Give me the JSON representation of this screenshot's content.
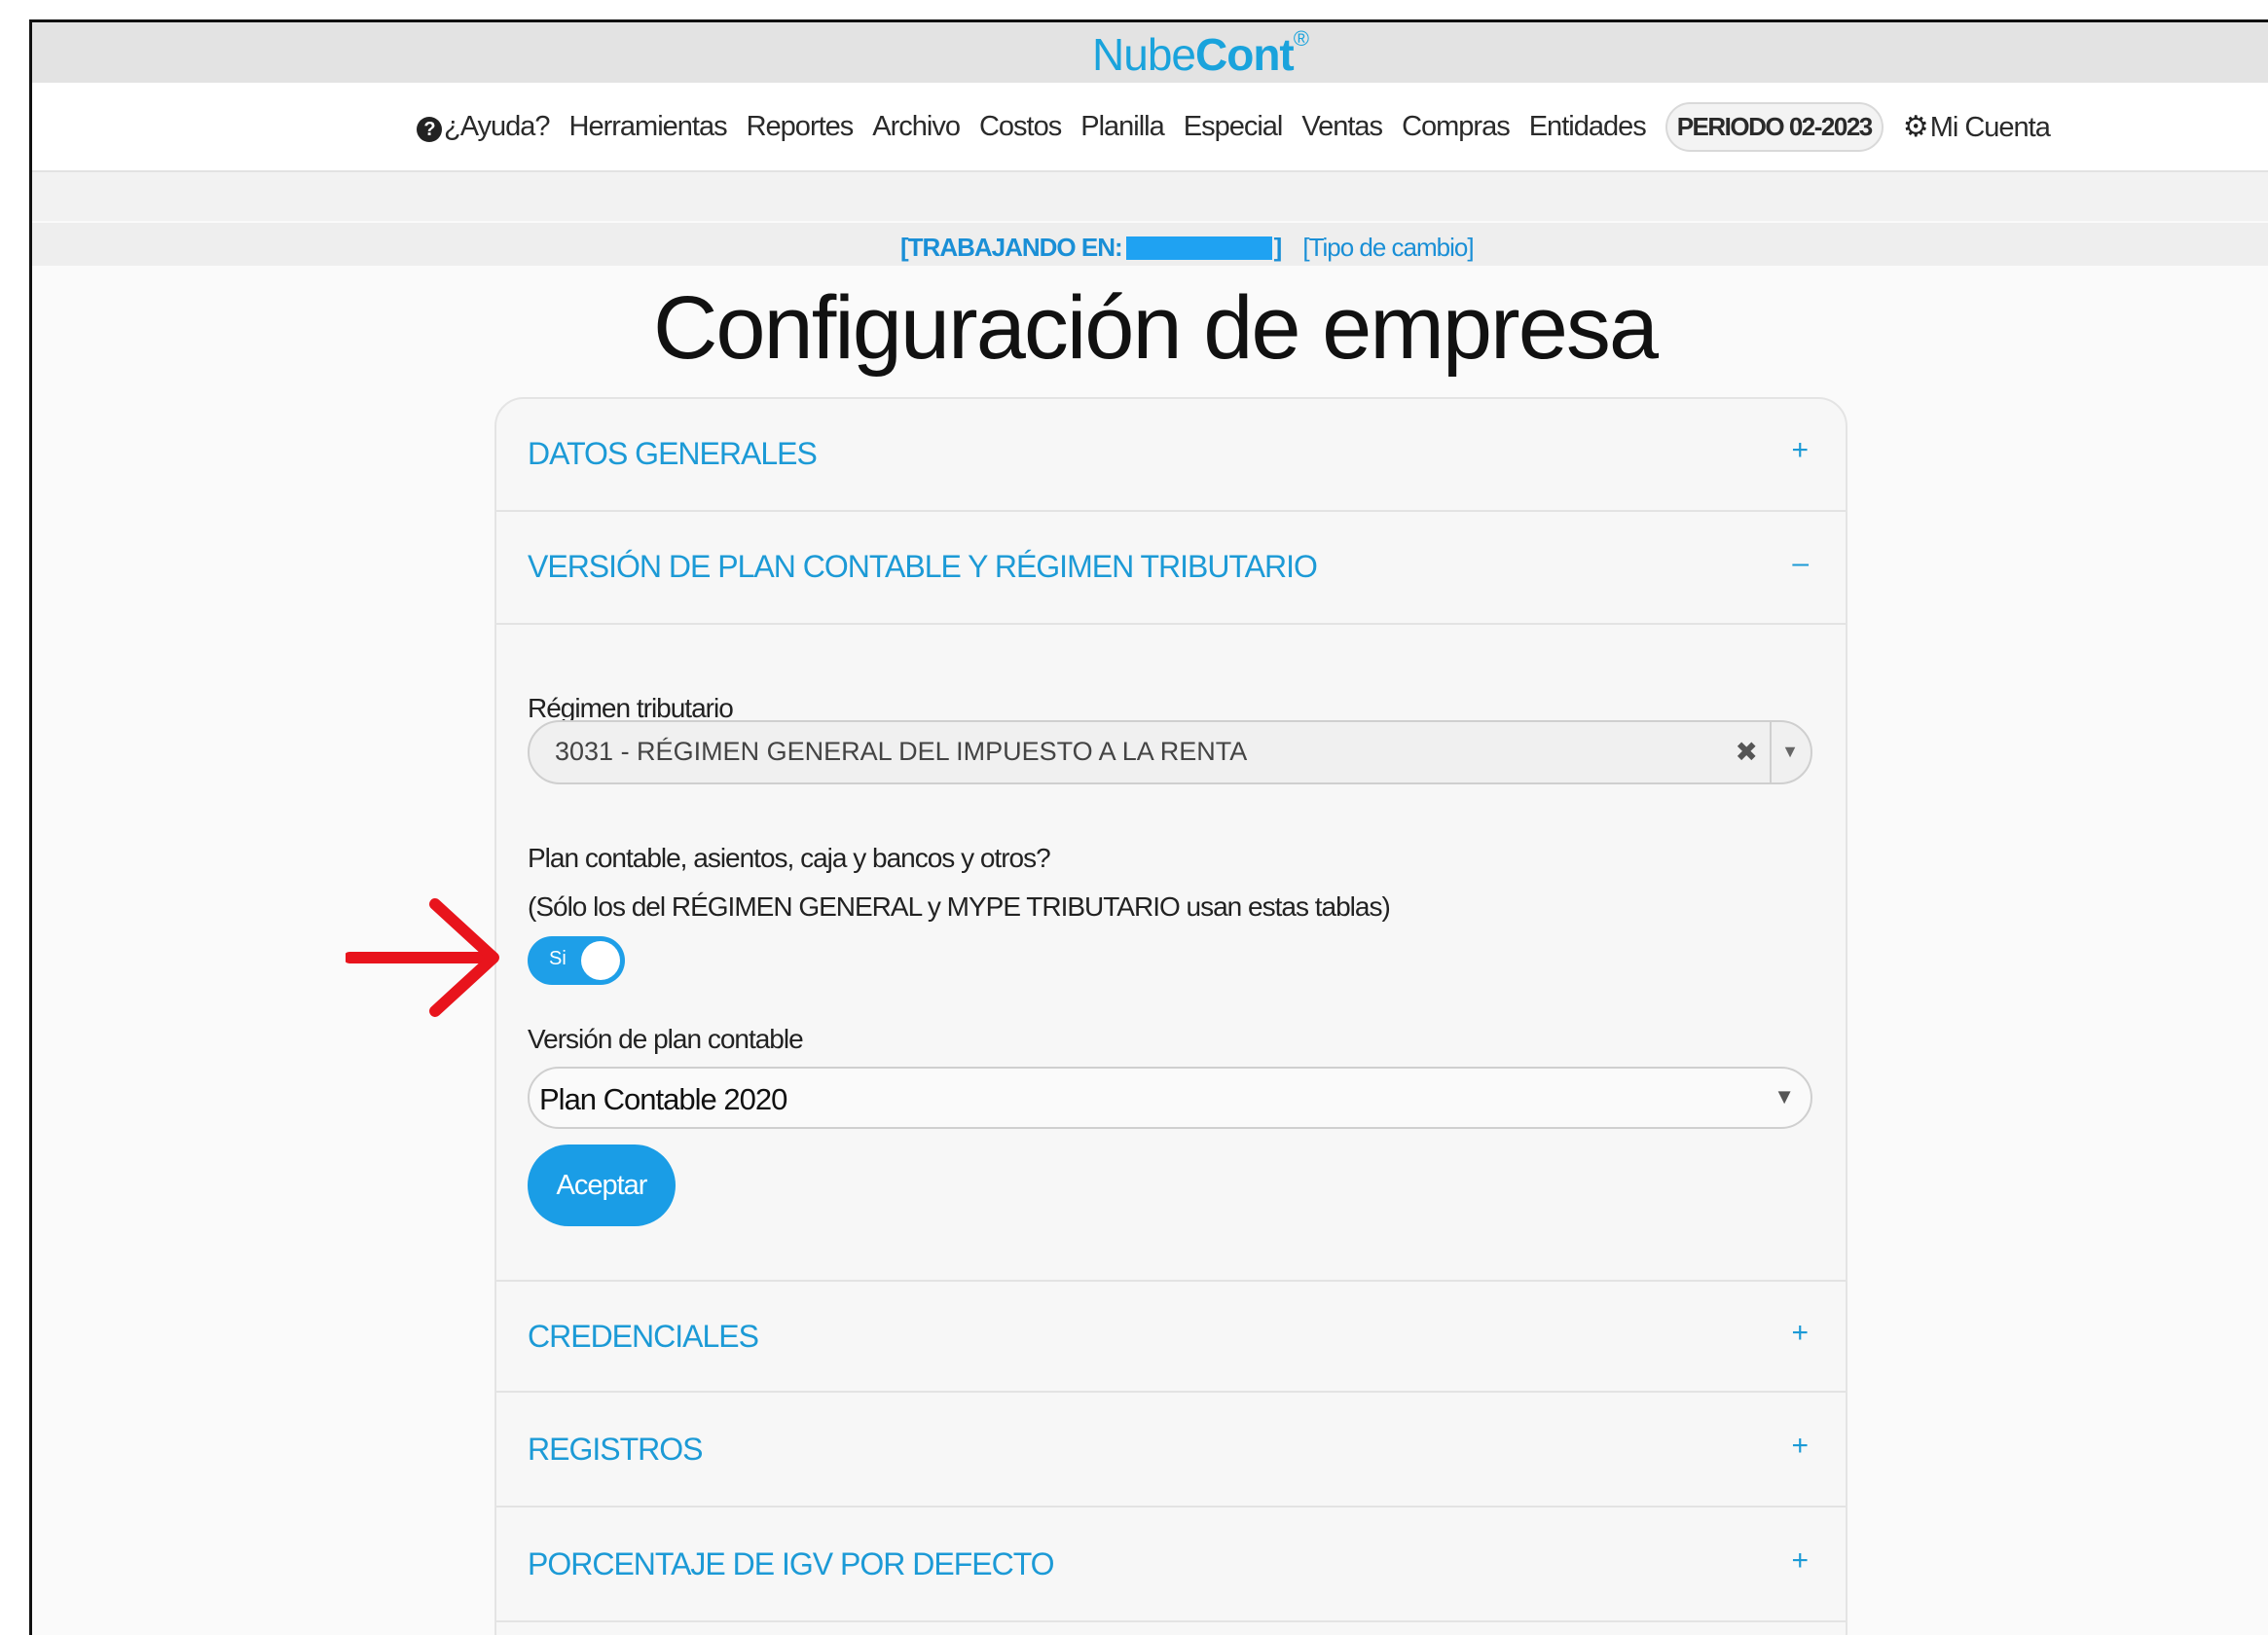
{
  "brand": {
    "name_light": "Nube",
    "name_bold": "Cont",
    "mark": "®"
  },
  "nav": {
    "items": [
      "¿Ayuda?",
      "Herramientas",
      "Reportes",
      "Archivo",
      "Costos",
      "Planilla",
      "Especial",
      "Ventas",
      "Compras",
      "Entidades"
    ],
    "periodo": "PERIODO 02-2023",
    "account": "Mi Cuenta",
    "help_icon": "question-circle-icon",
    "account_icon": "gear-icon"
  },
  "working": {
    "label": "[TRABAJANDO EN:",
    "close": "]",
    "exchange_link": "[Tipo de cambio]"
  },
  "page": {
    "title": "Configuración de empresa"
  },
  "sections": {
    "datos_generales": {
      "title": "DATOS GENERALES",
      "sign": "+"
    },
    "plan_contable": {
      "title": "VERSIÓN DE PLAN CONTABLE Y RÉGIMEN TRIBUTARIO",
      "sign": "–"
    },
    "credenciales": {
      "title": "CREDENCIALES",
      "sign": "+"
    },
    "registros": {
      "title": "REGISTROS",
      "sign": "+"
    },
    "igv": {
      "title": "PORCENTAJE DE IGV POR DEFECTO",
      "sign": "+"
    }
  },
  "form": {
    "regimen_label": "Régimen tributario",
    "regimen_value": "3031 - RÉGIMEN GENERAL DEL IMPUESTO A LA RENTA",
    "clear_symbol": "✖",
    "dropdown_symbol": "▼",
    "plan_question": "Plan contable, asientos, caja y bancos y otros?",
    "plan_note": "(Sólo los del RÉGIMEN GENERAL y MYPE TRIBUTARIO usan estas tablas)",
    "toggle_label": "Si",
    "toggle_on": true,
    "version_label": "Versión de plan contable",
    "version_value": "Plan Contable 2020",
    "submit_label": "Aceptar"
  },
  "colors": {
    "accent": "#1a9de6",
    "link": "#1c9ad6",
    "arrow": "#e8141c"
  }
}
